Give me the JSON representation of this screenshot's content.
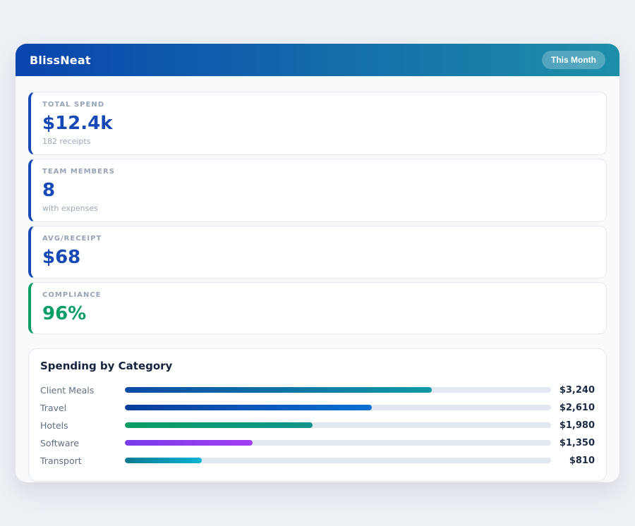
{
  "app": {
    "title": "BlissNeat",
    "period_badge": "This Month",
    "header_gradient": [
      "#0945ad",
      "#1d8fa8"
    ]
  },
  "stats": [
    {
      "label": "TOTAL SPEND",
      "value": "$12.4k",
      "sub": "182 receipts",
      "accent": "#1649b5",
      "value_color": "#1649b5"
    },
    {
      "label": "TEAM MEMBERS",
      "value": "8",
      "sub": "with expenses",
      "accent": "#1649b5",
      "value_color": "#1649b5"
    },
    {
      "label": "AVG/RECEIPT",
      "value": "$68",
      "sub": "",
      "accent": "#1649b5",
      "value_color": "#1649b5"
    },
    {
      "label": "COMPLIANCE",
      "value": "96%",
      "sub": "",
      "accent": "#089e66",
      "value_color": "#089e66"
    }
  ],
  "chart": {
    "title": "Spending by Category",
    "track_color": "#e2e8f0",
    "rows": [
      {
        "label": "Client Meals",
        "value_label": "$3,240",
        "pct": 72,
        "from": "#0b4aa6",
        "to": "#0f9aa5"
      },
      {
        "label": "Travel",
        "value_label": "$2,610",
        "pct": 58,
        "from": "#0a3d9c",
        "to": "#0b70d2"
      },
      {
        "label": "Hotels",
        "value_label": "$1,980",
        "pct": 44,
        "from": "#0a9d62",
        "to": "#12938e"
      },
      {
        "label": "Software",
        "value_label": "$1,350",
        "pct": 30,
        "from": "#7a3cea",
        "to": "#a03ef0"
      },
      {
        "label": "Transport",
        "value_label": "$810",
        "pct": 18,
        "from": "#0d7a92",
        "to": "#0bb3d4"
      }
    ]
  },
  "chart_data": {
    "type": "bar",
    "orientation": "horizontal",
    "title": "Spending by Category",
    "categories": [
      "Client Meals",
      "Travel",
      "Hotels",
      "Software",
      "Transport"
    ],
    "values": [
      3240,
      2610,
      1980,
      1350,
      810
    ],
    "value_labels": [
      "$3,240",
      "$2,610",
      "$1,980",
      "$1,350",
      "$810"
    ],
    "xlim": [
      0,
      4500
    ],
    "grid": false,
    "legend": false
  }
}
